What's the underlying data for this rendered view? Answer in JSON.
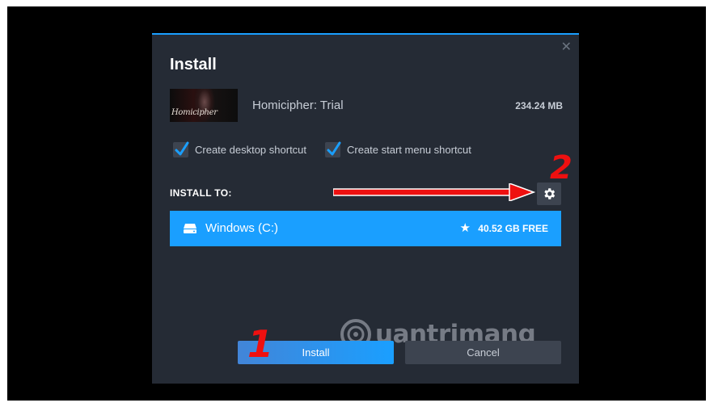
{
  "dialog": {
    "title": "Install",
    "close_icon": "close-icon"
  },
  "game": {
    "thumbnail_text": "Homicipher",
    "name": "Homicipher: Trial",
    "size": "234.24 MB"
  },
  "options": {
    "desktop_shortcut_label": "Create desktop shortcut",
    "desktop_shortcut_checked": true,
    "start_menu_shortcut_label": "Create start menu shortcut",
    "start_menu_shortcut_checked": true
  },
  "install_to": {
    "label": "INSTALL TO:",
    "settings_icon": "gear-icon",
    "drive_icon": "hard-drive-icon",
    "drive_name": "Windows (C:)",
    "default_icon": "star-icon",
    "free_space": "40.52 GB FREE"
  },
  "annotations": {
    "step_1": "1",
    "step_2": "2",
    "arrow_icon": "arrow-right-icon",
    "arrow_color": "#ee1010"
  },
  "buttons": {
    "install": "Install",
    "cancel": "Cancel"
  },
  "watermark": {
    "text": "uantrimang"
  },
  "colors": {
    "accent": "#1a9fff",
    "dialog_bg": "#252b35",
    "control_bg": "#3d4450",
    "text": "#c7cdd6"
  }
}
